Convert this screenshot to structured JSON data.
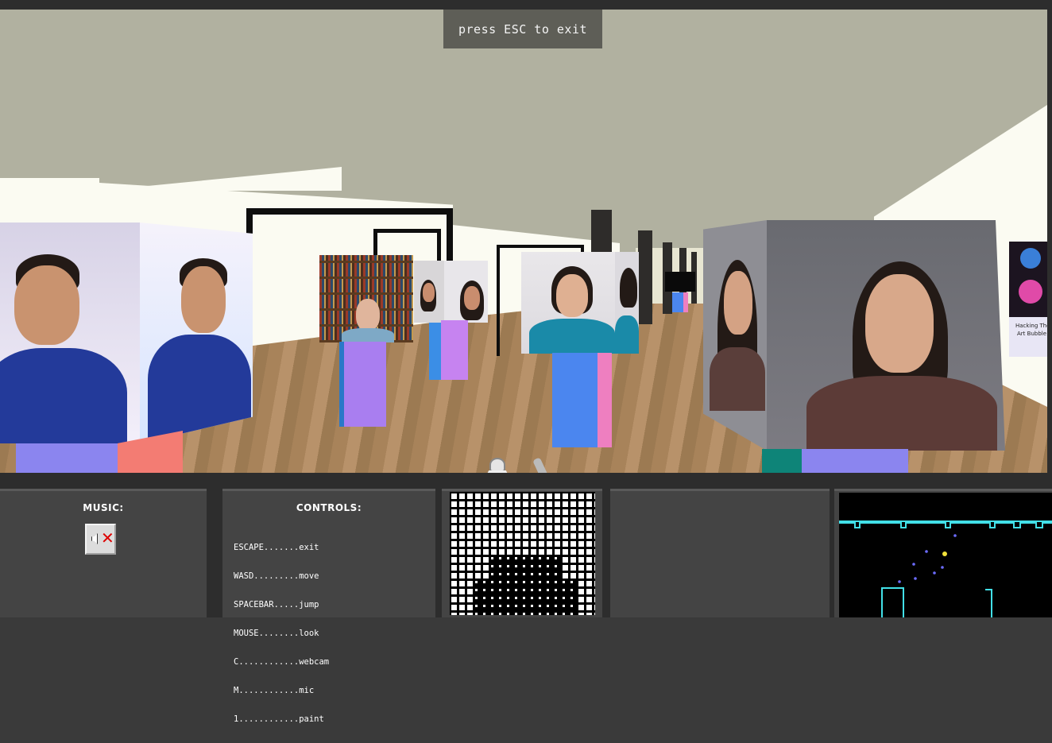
{
  "banner": {
    "exit_text": "press ESC to exit"
  },
  "poster": {
    "text_line1": "Hacking The",
    "text_line2": "Art Bubble"
  },
  "music_panel": {
    "title": "MUSIC:",
    "button_icon": "speaker-muted-icon"
  },
  "controls_panel": {
    "title": "CONTROLS:",
    "items": [
      {
        "keys": "ESCAPE.......",
        "action": "exit"
      },
      {
        "keys": "WASD.........",
        "action": "move"
      },
      {
        "keys": "SPACEBAR.....",
        "action": "jump"
      },
      {
        "keys": "MOUSE........",
        "action": "look"
      },
      {
        "keys": "C............",
        "action": "webcam"
      },
      {
        "keys": "M............",
        "action": "mic"
      },
      {
        "keys": "1............",
        "action": "paint"
      }
    ]
  },
  "colors": {
    "sky": "#b1b1a0",
    "wall": "#fbfbf2",
    "panel_bg": "#444444",
    "pedestal_purple": "#a97ef0",
    "pedestal_blue": "#4b86ef",
    "pedestal_pink": "#ee7fc0",
    "pedestal_salmon": "#f37c73",
    "pedestal_teal": "#0e8478",
    "game_cyan": "#42e0e8"
  }
}
